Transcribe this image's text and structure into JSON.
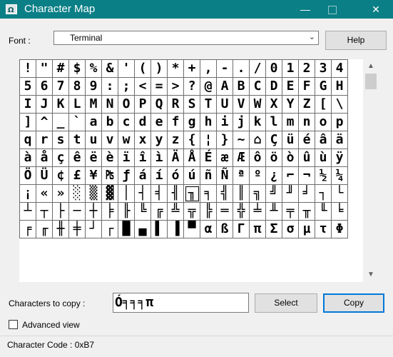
{
  "window": {
    "title": "Character Map",
    "icon": "character-map-icon",
    "controls": {
      "minimize": "—",
      "maximize": "",
      "close": "✕"
    }
  },
  "font": {
    "label": "Font :",
    "value": "Terminal"
  },
  "help_label": "Help",
  "grid": {
    "rows": [
      [
        "!",
        "\"",
        "#",
        "$",
        "%",
        "&",
        "'",
        "(",
        ")",
        "*",
        "+",
        ",",
        "-",
        ".",
        "/",
        "0",
        "1",
        "2",
        "3",
        "4"
      ],
      [
        "5",
        "6",
        "7",
        "8",
        "9",
        ":",
        ";",
        "<",
        "=",
        ">",
        "?",
        "@",
        "A",
        "B",
        "C",
        "D",
        "E",
        "F",
        "G",
        "H"
      ],
      [
        "I",
        "J",
        "K",
        "L",
        "M",
        "N",
        "O",
        "P",
        "Q",
        "R",
        "S",
        "T",
        "U",
        "V",
        "W",
        "X",
        "Y",
        "Z",
        "[",
        "\\"
      ],
      [
        "]",
        "^",
        "_",
        "`",
        "a",
        "b",
        "c",
        "d",
        "e",
        "f",
        "g",
        "h",
        "i",
        "j",
        "k",
        "l",
        "m",
        "n",
        "o",
        "p"
      ],
      [
        "q",
        "r",
        "s",
        "t",
        "u",
        "v",
        "w",
        "x",
        "y",
        "z",
        "{",
        "¦",
        "}",
        "~",
        "⌂",
        "Ç",
        "ü",
        "é",
        "â",
        "ä"
      ],
      [
        "à",
        "å",
        "ç",
        "ê",
        "ë",
        "è",
        "ï",
        "î",
        "ì",
        "Ä",
        "Å",
        "É",
        "æ",
        "Æ",
        "ô",
        "ö",
        "ò",
        "û",
        "ù",
        "ÿ"
      ],
      [
        "Ö",
        "Ü",
        "¢",
        "£",
        "¥",
        "₧",
        "ƒ",
        "á",
        "í",
        "ó",
        "ú",
        "ñ",
        "Ñ",
        "ª",
        "º",
        "¿",
        "⌐",
        "¬",
        "½",
        "¼"
      ],
      [
        "¡",
        "«",
        "»",
        "░",
        "▒",
        "▓",
        "│",
        "┤",
        "╡",
        "╢",
        "╖",
        "╕",
        "╣",
        "║",
        "╗",
        "╝",
        "╜",
        "╛",
        "┐",
        "└"
      ],
      [
        "┴",
        "┬",
        "├",
        "─",
        "┼",
        "╞",
        "╟",
        "╚",
        "╔",
        "╩",
        "╦",
        "╠",
        "═",
        "╬",
        "╧",
        "╨",
        "╤",
        "╥",
        "╙",
        "╘"
      ],
      [
        "╒",
        "╓",
        "╫",
        "╪",
        "┘",
        "┌",
        "█",
        "▄",
        "▌",
        "▐",
        "▀",
        "α",
        "ß",
        "Γ",
        "π",
        "Σ",
        "σ",
        "µ",
        "τ",
        "Φ"
      ]
    ],
    "selected": {
      "row": 7,
      "col": 10
    }
  },
  "copy": {
    "label": "Characters to copy :",
    "value": "Ó╕╕╕π"
  },
  "select_label": "Select",
  "copy_label": "Copy",
  "advanced_view": {
    "label": "Advanced view",
    "checked": false
  },
  "status": {
    "text": "Character Code : 0xB7"
  },
  "scrollbar": {
    "up": "▲",
    "down": "▼"
  }
}
